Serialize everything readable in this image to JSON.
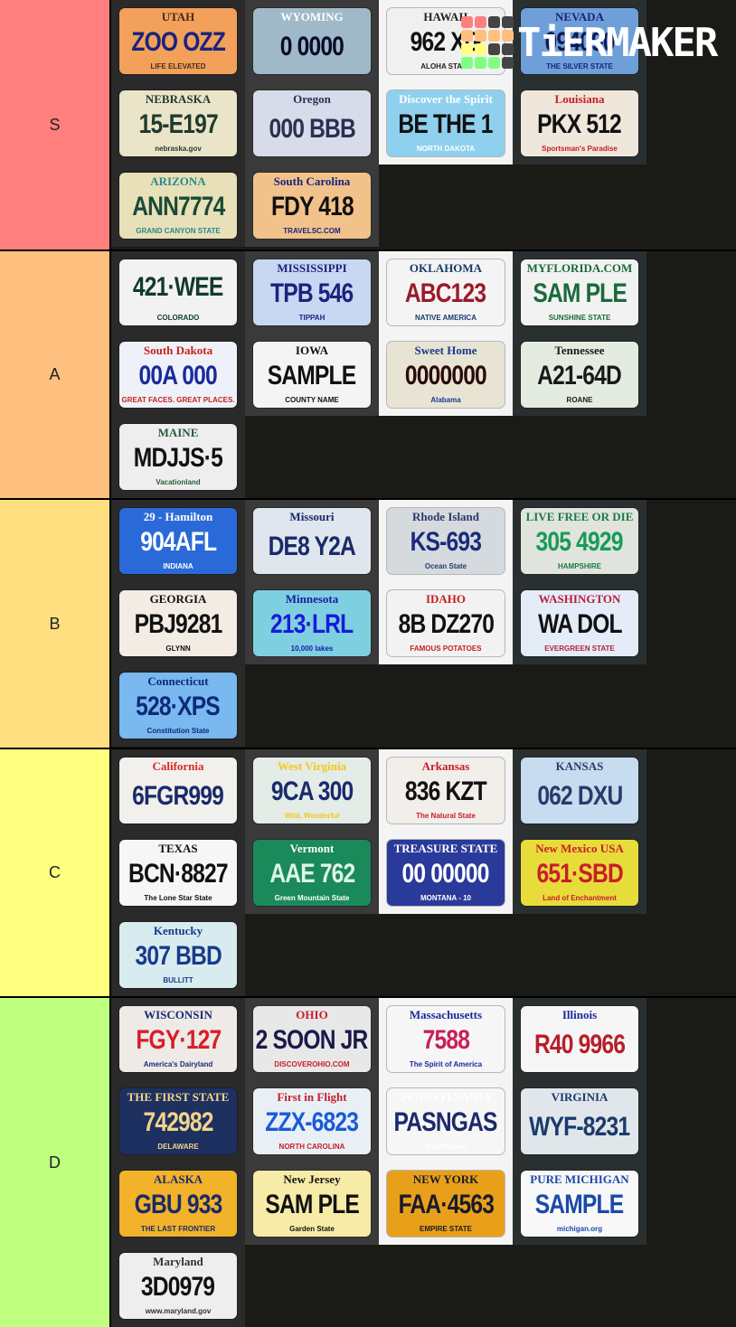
{
  "watermark": {
    "text": "TiERMAKER",
    "grid_colors": [
      "#ff7f7f",
      "#ff7f7f",
      "#444",
      "#444",
      "#ffbf7f",
      "#ffbf7f",
      "#ffbf7f",
      "#ffbf7f",
      "#ffff7f",
      "#ffff7f",
      "#444",
      "#444",
      "#7fff7f",
      "#7fff7f",
      "#7fff7f",
      "#444"
    ]
  },
  "tiers": [
    {
      "label": "S",
      "color": "#ff7f7f",
      "items": [
        {
          "state": "UTAH",
          "number": "ZOO OZZ",
          "slogan": "LIFE ELEVATED",
          "bg": "#f2a05a",
          "fg": "#1a237e",
          "sc": "#4a2a1a"
        },
        {
          "state": "WYOMING",
          "number": "0 0000",
          "slogan": "",
          "bg": "#9fb9c8",
          "fg": "#0a0a2a",
          "sc": "#ffffff"
        },
        {
          "state": "HAWAII",
          "number": "962 XG",
          "slogan": "ALOHA STATE",
          "bg": "#f0f0f0",
          "fg": "#111111",
          "sc": "#222222"
        },
        {
          "state": "NEVADA",
          "number": "094090",
          "slogan": "THE SILVER STATE",
          "bg": "#6f9fd8",
          "fg": "#0d1a5a",
          "sc": "#1a237e"
        },
        {
          "state": "NEBRASKA",
          "number": "15-E197",
          "slogan": "nebraska.gov",
          "bg": "#eae4c8",
          "fg": "#1f3a2e",
          "sc": "#1f3a2e"
        },
        {
          "state": "Oregon",
          "number": "000 BBB",
          "slogan": "",
          "bg": "#d8dcea",
          "fg": "#2a3050",
          "sc": "#2a3050"
        },
        {
          "state": "Discover the Spirit",
          "number": "BE THE 1",
          "slogan": "NORTH DAKOTA",
          "bg": "#8fd0ee",
          "fg": "#111111",
          "sc": "#ffffff"
        },
        {
          "state": "Louisiana",
          "number": "PKX 512",
          "slogan": "Sportsman's Paradise",
          "bg": "#efe6dc",
          "fg": "#111111",
          "sc": "#c81e1e"
        },
        {
          "state": "ARIZONA",
          "number": "ANN7774",
          "slogan": "GRAND CANYON STATE",
          "bg": "#e8e0b8",
          "fg": "#1a4a38",
          "sc": "#2a8a8a"
        },
        {
          "state": "South Carolina",
          "number": "FDY 418",
          "slogan": "TRAVELSC.COM",
          "bg": "#f1c28a",
          "fg": "#111111",
          "sc": "#1a237e"
        }
      ]
    },
    {
      "label": "A",
      "color": "#ffbf7f",
      "items": [
        {
          "state": "",
          "number": "421·WEE",
          "slogan": "COLORADO",
          "bg": "#f2f2f2",
          "fg": "#123a2a",
          "sc": "#123a2a"
        },
        {
          "state": "MISSISSIPPI",
          "number": "TPB 546",
          "slogan": "TIPPAH",
          "bg": "#c9d8f2",
          "fg": "#1a237e",
          "sc": "#1a237e"
        },
        {
          "state": "OKLAHOMA",
          "number": "ABC123",
          "slogan": "NATIVE AMERICA",
          "bg": "#f4f4f4",
          "fg": "#9a1a2a",
          "sc": "#1a3a6a"
        },
        {
          "state": "MYFLORIDA.COM",
          "number": "SAM PLE",
          "slogan": "SUNSHINE STATE",
          "bg": "#f2f2f2",
          "fg": "#1a6a3a",
          "sc": "#1a6a3a"
        },
        {
          "state": "South Dakota",
          "number": "00A 000",
          "slogan": "GREAT FACES. GREAT PLACES.",
          "bg": "#eef2f8",
          "fg": "#1a2a9a",
          "sc": "#c81e1e"
        },
        {
          "state": "IOWA",
          "number": "SAMPLE",
          "slogan": "COUNTY NAME",
          "bg": "#f4f4f4",
          "fg": "#111111",
          "sc": "#111111"
        },
        {
          "state": "Sweet Home",
          "number": "0000000",
          "slogan": "Alabama",
          "bg": "#e8e4d4",
          "fg": "#2a0a0a",
          "sc": "#1a3a8a"
        },
        {
          "state": "Tennessee",
          "number": "A21-64D",
          "slogan": "ROANE",
          "bg": "#e4ece0",
          "fg": "#1a1a1a",
          "sc": "#1a1a1a"
        },
        {
          "state": "MAINE",
          "number": "MDJJS·5",
          "slogan": "Vacationland",
          "bg": "#eeeeee",
          "fg": "#111111",
          "sc": "#2a5a3a"
        }
      ]
    },
    {
      "label": "B",
      "color": "#ffdf7f",
      "items": [
        {
          "state": "29 - Hamilton",
          "number": "904AFL",
          "slogan": "INDIANA",
          "bg": "#2a6ad8",
          "fg": "#ffffff",
          "sc": "#ffffff"
        },
        {
          "state": "Missouri",
          "number": "DE8 Y2A",
          "slogan": "",
          "bg": "#dfe6ee",
          "fg": "#1a2a6a",
          "sc": "#1a2a6a"
        },
        {
          "state": "Rhode Island",
          "number": "KS-693",
          "slogan": "Ocean State",
          "bg": "#d4dade",
          "fg": "#1a2a7a",
          "sc": "#2a3a6a"
        },
        {
          "state": "LIVE FREE OR DIE",
          "number": "305 4929",
          "slogan": "HAMPSHIRE",
          "bg": "#e0e4dc",
          "fg": "#1a9a5a",
          "sc": "#1a7a4a"
        },
        {
          "state": "GEORGIA",
          "number": "PBJ9281",
          "slogan": "GLYNN",
          "bg": "#f2ece4",
          "fg": "#111111",
          "sc": "#111111"
        },
        {
          "state": "Minnesota",
          "number": "213·LRL",
          "slogan": "10,000 lakes",
          "bg": "#7ed0e0",
          "fg": "#1a1ad8",
          "sc": "#1a1aa8"
        },
        {
          "state": "IDAHO",
          "number": "8B DZ270",
          "slogan": "FAMOUS POTATOES",
          "bg": "#f2f2f2",
          "fg": "#111111",
          "sc": "#c81e1e"
        },
        {
          "state": "WASHINGTON",
          "number": "WA DOL",
          "slogan": "EVERGREEN STATE",
          "bg": "#e4ecf8",
          "fg": "#111111",
          "sc": "#b81e3a"
        },
        {
          "state": "Connecticut",
          "number": "528·XPS",
          "slogan": "Constitution State",
          "bg": "#7ab8f0",
          "fg": "#0d2a7a",
          "sc": "#0d2a7a"
        }
      ]
    },
    {
      "label": "C",
      "color": "#ffff7f",
      "items": [
        {
          "state": "California",
          "number": "6FGR999",
          "slogan": "",
          "bg": "#f2f0ec",
          "fg": "#1a2a6a",
          "sc": "#d82a2a"
        },
        {
          "state": "West Virginia",
          "number": "9CA 300",
          "slogan": "Wild, Wonderful",
          "bg": "#e4ece8",
          "fg": "#1a2a6a",
          "sc": "#f2c81a"
        },
        {
          "state": "Arkansas",
          "number": "836 KZT",
          "slogan": "The Natural State",
          "bg": "#f2eeea",
          "fg": "#111111",
          "sc": "#c81e2a"
        },
        {
          "state": "KANSAS",
          "number": "062 DXU",
          "slogan": "",
          "bg": "#c8dcf0",
          "fg": "#2a3a6a",
          "sc": "#2a3a6a"
        },
        {
          "state": "TEXAS",
          "number": "BCN·8827",
          "slogan": "The Lone Star State",
          "bg": "#f6f6f6",
          "fg": "#111111",
          "sc": "#111111"
        },
        {
          "state": "Vermont",
          "number": "AAE 762",
          "slogan": "Green Mountain State",
          "bg": "#1a8a5a",
          "fg": "#e0f4ea",
          "sc": "#ffffff"
        },
        {
          "state": "TREASURE STATE",
          "number": "00 00000",
          "slogan": "MONTANA - 10",
          "bg": "#2a3a9a",
          "fg": "#ffffff",
          "sc": "#ffffff"
        },
        {
          "state": "New Mexico USA",
          "number": "651·SBD",
          "slogan": "Land of Enchantment",
          "bg": "#e8dc3a",
          "fg": "#c81e2a",
          "sc": "#c81e2a"
        },
        {
          "state": "Kentucky",
          "number": "307 BBD",
          "slogan": "BULLITT",
          "bg": "#d8ecf0",
          "fg": "#1a3a8a",
          "sc": "#1a3a8a"
        }
      ]
    },
    {
      "label": "D",
      "color": "#bfff7f",
      "items": [
        {
          "state": "WISCONSIN",
          "number": "FGY·127",
          "slogan": "America's Dairyland",
          "bg": "#eeeae6",
          "fg": "#d81e2a",
          "sc": "#1a2a7a"
        },
        {
          "state": "OHIO",
          "number": "2 SOON JR",
          "slogan": "DISCOVEROHIO.COM",
          "bg": "#e8e8e8",
          "fg": "#1a1a4a",
          "sc": "#c81e2a"
        },
        {
          "state": "Massachusetts",
          "number": "7588",
          "slogan": "The Spirit of America",
          "bg": "#f6f6f6",
          "fg": "#c81e5a",
          "sc": "#1a2a9a"
        },
        {
          "state": "Illinois",
          "number": "R40 9966",
          "slogan": "",
          "bg": "#f6f6f6",
          "fg": "#b81e2a",
          "sc": "#1a2a9a"
        },
        {
          "state": "THE FIRST STATE",
          "number": "742982",
          "slogan": "DELAWARE",
          "bg": "#1e3060",
          "fg": "#f2d48a",
          "sc": "#f2d48a"
        },
        {
          "state": "First in Flight",
          "number": "ZZX-6823",
          "slogan": "NORTH CAROLINA",
          "bg": "#e8f0f6",
          "fg": "#1a5ad8",
          "sc": "#c81e2a"
        },
        {
          "state": "PENNSYLVANIA",
          "number": "PASNGAS",
          "slogan": "visitPA.com",
          "bg": "#f6f6f6",
          "fg": "#1a2a6a",
          "sc": "#ffffff"
        },
        {
          "state": "VIRGINIA",
          "number": "WYF-8231",
          "slogan": "",
          "bg": "#e0e6ea",
          "fg": "#1a3a6a",
          "sc": "#1a3a6a"
        },
        {
          "state": "ALASKA",
          "number": "GBU 933",
          "slogan": "THE LAST FRONTIER",
          "bg": "#f2b22a",
          "fg": "#1a2a6a",
          "sc": "#1a2a6a"
        },
        {
          "state": "New Jersey",
          "number": "SAM PLE",
          "slogan": "Garden State",
          "bg": "#f6eca8",
          "fg": "#111111",
          "sc": "#111111"
        },
        {
          "state": "NEW YORK",
          "number": "FAA·4563",
          "slogan": "EMPIRE STATE",
          "bg": "#e8a01a",
          "fg": "#1a1a2a",
          "sc": "#1a1a2a"
        },
        {
          "state": "PURE MICHIGAN",
          "number": "SAMPLE",
          "slogan": "michigan.org",
          "bg": "#f8f8f8",
          "fg": "#1a4aa8",
          "sc": "#1a4aa8"
        },
        {
          "state": "Maryland",
          "number": "3D0979",
          "slogan": "www.maryland.gov",
          "bg": "#eeeeee",
          "fg": "#111111",
          "sc": "#333333"
        }
      ]
    }
  ]
}
